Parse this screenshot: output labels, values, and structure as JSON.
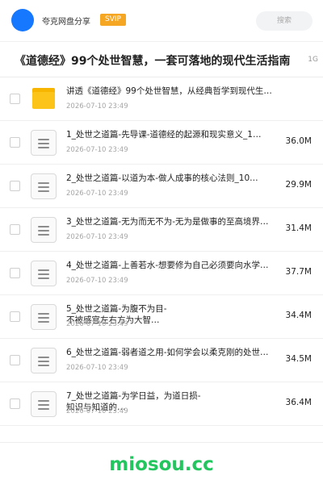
{
  "header": {
    "share_name": "夸克网盘分享",
    "badge": "SVIP",
    "search_placeholder": "搜索"
  },
  "title": {
    "text": "《道德经》99个处世智慧，一套可落地的现代生活指南",
    "size_suffix": "1G"
  },
  "files": [
    {
      "type": "folder",
      "name": "讲透《道德经》99个处世智慧，从经典哲学到现代生活…",
      "date": "2026-07-10 23:49",
      "size": ""
    },
    {
      "type": "doc",
      "name": "1_处世之道篇-先导课-道德经的起源和现实意义_1…",
      "date": "2026-07-10 23:49",
      "size": "36.0M"
    },
    {
      "type": "doc",
      "name": "2_处世之道篇-以道为本-做人成事的核心法则_10…",
      "date": "2026-07-10 23:49",
      "size": "29.9M"
    },
    {
      "type": "doc",
      "name": "3_处世之道篇-无为而无不为-无为是做事的至高境界…",
      "date": "2026-07-10 23:49",
      "size": "31.4M"
    },
    {
      "type": "doc",
      "name": "4_处世之道篇-上善若水-想要修为自己必须要向水学…",
      "date": "2026-07-10 23:49",
      "size": "37.7M"
    },
    {
      "type": "doc",
      "name": "5_处世之道篇-为腹不为目-\n不被感官左右方为大智…",
      "date": "2026-07-10 23:49",
      "size": "34.4M"
    },
    {
      "type": "doc",
      "name": "6_处世之道篇-弱者道之用-如何学会以柔克刚的处世…",
      "date": "2026-07-10 23:49",
      "size": "34.5M"
    },
    {
      "type": "doc",
      "name": "7_处世之道篇-为学日益，为道日损-\n知识与知道的…",
      "date": "2026-07-10 23:49",
      "size": "36.4M"
    }
  ],
  "footer": {
    "watermark": "miosou.cc"
  }
}
